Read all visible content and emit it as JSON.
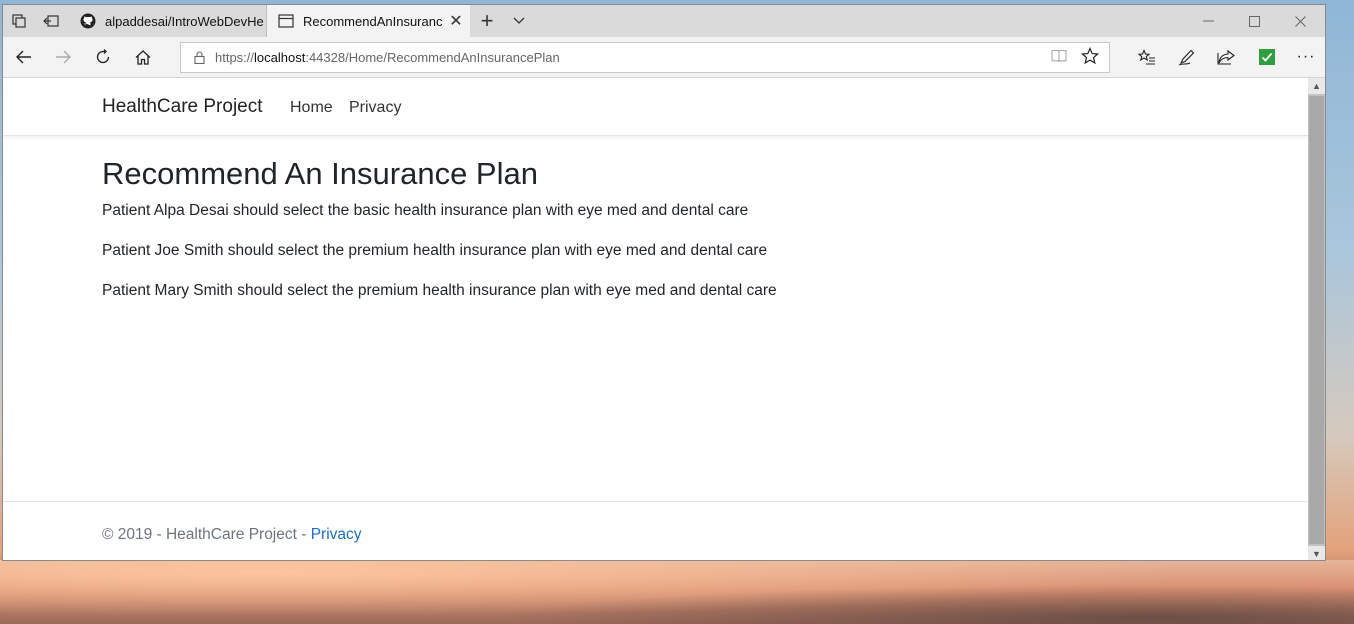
{
  "browser": {
    "tabs": [
      {
        "title": "alpaddesai/IntroWebDevHe",
        "active": false,
        "icon": "github-icon"
      },
      {
        "title": "RecommendAnInsuranc",
        "active": true,
        "icon": "page-icon"
      }
    ],
    "address": {
      "scheme": "https://",
      "host": "localhost",
      "path": ":44328/Home/RecommendAnInsurancePlan"
    },
    "extension_color": "#2e9e3e"
  },
  "site": {
    "brand": "HealthCare Project",
    "nav": [
      {
        "label": "Home"
      },
      {
        "label": "Privacy"
      }
    ]
  },
  "main": {
    "title": "Recommend An Insurance Plan",
    "recommendations": [
      "Patient Alpa Desai should select the basic health insurance plan with eye med and dental care",
      "Patient Joe Smith should select the premium health insurance plan with eye med and dental care",
      "Patient Mary Smith should select the premium health insurance plan with eye med and dental care"
    ]
  },
  "footer": {
    "text": "© 2019 - HealthCare Project - ",
    "link": "Privacy",
    "link_color": "#1b6ec2"
  }
}
